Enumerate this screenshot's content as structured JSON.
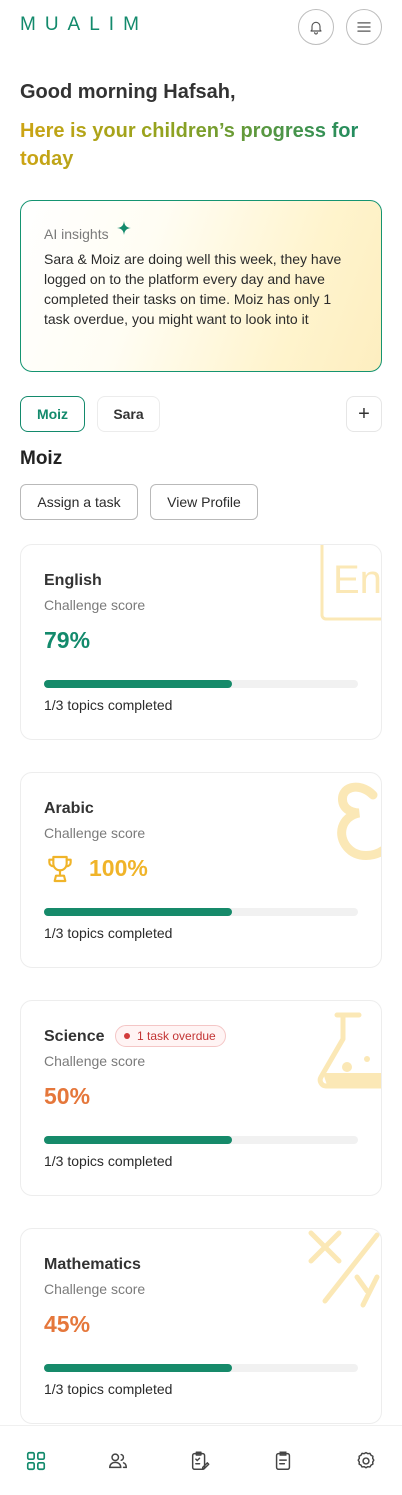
{
  "app": {
    "logo": "MUALIM"
  },
  "greeting": "Good morning Hafsah,",
  "subtitle": "Here is your children’s progress for today",
  "insights": {
    "title": "AI insights",
    "text": "Sara & Moiz are doing well this week, they have logged on to the platform every day and have completed their tasks on time. Moiz has only 1 task overdue, you might want to look into it"
  },
  "children_tabs": [
    {
      "label": "Moiz",
      "selected": true
    },
    {
      "label": "Sara",
      "selected": false
    }
  ],
  "add_child_label": "+",
  "selected_child": "Moiz",
  "actions": {
    "assign": "Assign a task",
    "profile": "View Profile"
  },
  "subjects": [
    {
      "name": "English",
      "score_label": "Challenge score",
      "score": "79%",
      "progress": 0.6,
      "topics": "1/3 topics completed",
      "color": "#138a6c"
    },
    {
      "name": "Arabic",
      "score_label": "Challenge score",
      "score": "100%",
      "progress": 0.6,
      "topics": "1/3 topics completed",
      "color": "#f0b429"
    },
    {
      "name": "Science",
      "score_label": "Challenge score",
      "score": "50%",
      "progress": 0.6,
      "topics": "1/3 topics completed",
      "badge": "1 task overdue",
      "color": "#e5773b"
    },
    {
      "name": "Mathematics",
      "score_label": "Challenge score",
      "score": "45%",
      "progress": 0.6,
      "topics": "1/3 topics completed",
      "color": "#e5773b"
    }
  ],
  "bottom_nav": [
    "dashboard-icon",
    "children-icon",
    "tasks-icon",
    "reports-icon",
    "settings-icon"
  ],
  "colors": {
    "brand": "#138a6c",
    "accent": "#f0b429",
    "warning": "#e5773b",
    "danger": "#c23434"
  }
}
